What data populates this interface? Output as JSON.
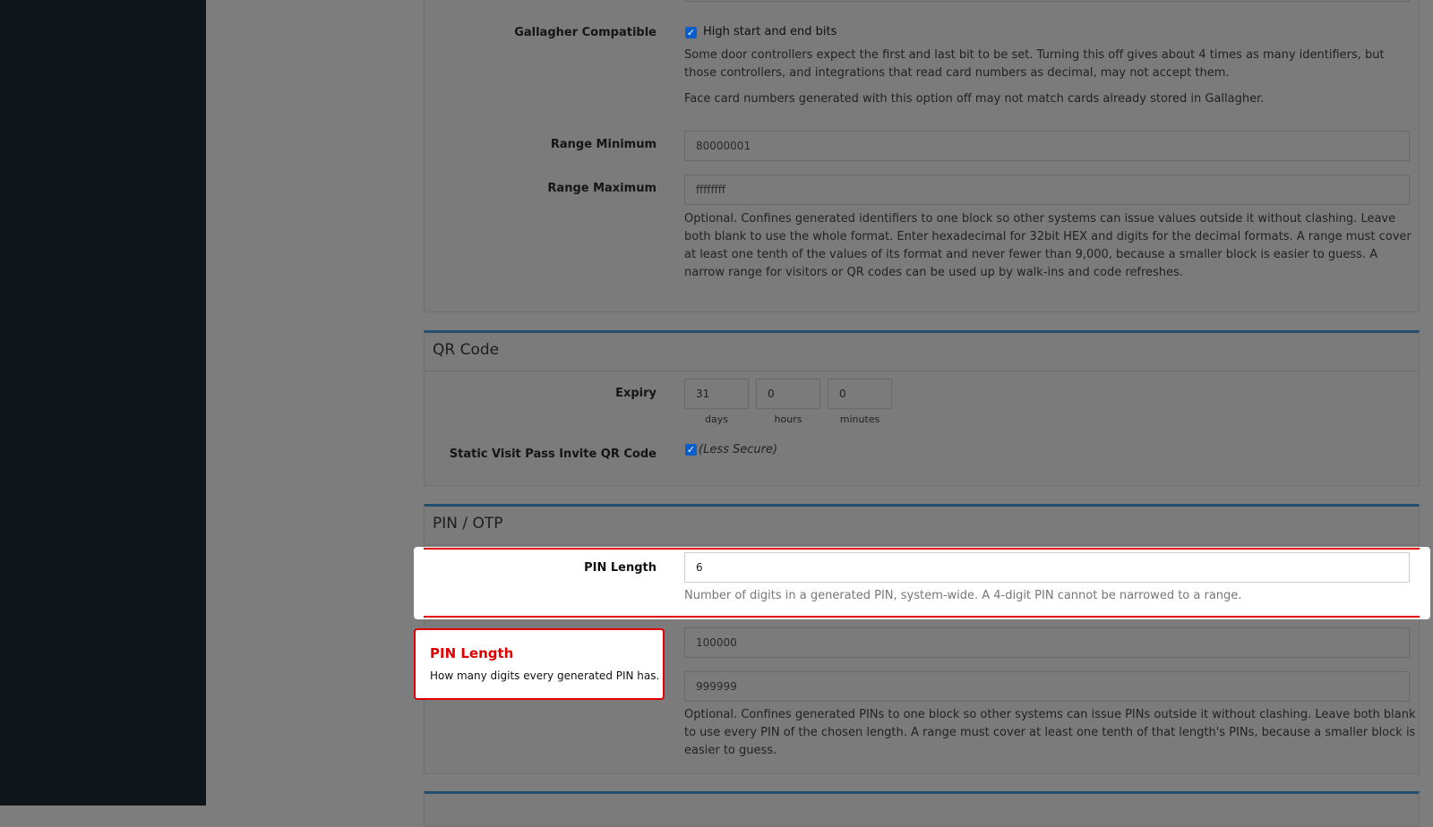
{
  "gallagher": {
    "label": "Gallagher Compatible",
    "checkbox_label": "High start and end bits",
    "help1": "Some door controllers expect the first and last bit to be set. Turning this off gives about 4 times as many identifiers, but those controllers, and integrations that read card numbers as decimal, may not accept them.",
    "help2": "Face card numbers generated with this option off may not match cards already stored in Gallagher."
  },
  "range": {
    "min_label": "Range Minimum",
    "min_placeholder": "80000001",
    "max_label": "Range Maximum",
    "max_placeholder": "ffffffff",
    "help": "Optional. Confines generated identifiers to one block so other systems can issue values outside it without clashing. Leave both blank to use the whole format. Enter hexadecimal for 32bit HEX and digits for the decimal formats. A range must cover at least one tenth of the values of its format and never fewer than 9,000, because a smaller block is easier to guess. A narrow range for visitors or QR codes can be used up by walk-ins and code refreshes."
  },
  "qr": {
    "title": "QR Code",
    "expiry_label": "Expiry",
    "days": "31",
    "hours": "0",
    "minutes": "0",
    "days_unit": "days",
    "hours_unit": "hours",
    "minutes_unit": "minutes",
    "static_label": "Static Visit Pass Invite QR Code",
    "static_note": "(Less Secure)"
  },
  "pin": {
    "title": "PIN / OTP",
    "length_label": "PIN Length",
    "length_value": "6",
    "length_help": "Number of digits in a generated PIN, system-wide. A 4-digit PIN cannot be narrowed to a range.",
    "min_placeholder": "100000",
    "max_placeholder": "999999",
    "range_help": "Optional. Confines generated PINs to one block so other systems can issue PINs outside it without clashing. Leave both blank to use every PIN of the chosen length. A range must cover at least one tenth of that length's PINs, because a smaller block is easier to guess."
  },
  "tooltip": {
    "title": "PIN Length",
    "body": "How many digits every generated PIN has."
  },
  "colors": {
    "sidebar": "#0f161b",
    "section_border": "#244e6c",
    "checkbox": "#0a5ecc",
    "highlight_red": "#e00000"
  }
}
